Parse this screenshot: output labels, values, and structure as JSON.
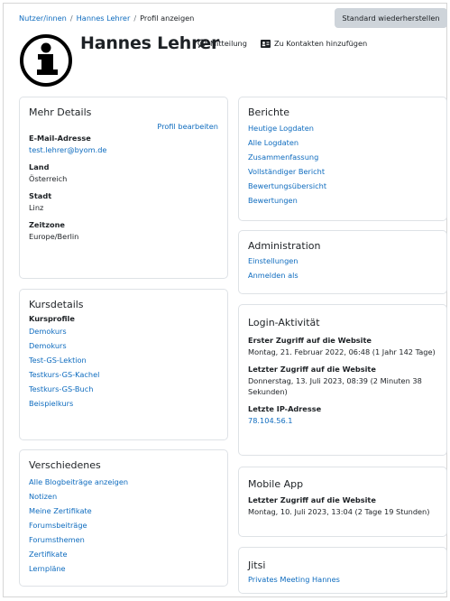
{
  "breadcrumb": {
    "items": [
      "Nutzer/innen",
      "Hannes Lehrer",
      "Profil anzeigen"
    ],
    "separator": "/"
  },
  "reset_button": "Standard wiederherstellen",
  "user": {
    "name": "Hannes Lehrer"
  },
  "header_actions": {
    "message": "Mitteilung",
    "add_contact": "Zu Kontakten hinzufügen"
  },
  "more_details": {
    "title": "Mehr Details",
    "edit": "Profil bearbeiten",
    "fields": [
      {
        "label": "E-Mail-Adresse",
        "value": "test.lehrer@byom.de"
      },
      {
        "label": "Land",
        "value": "Österreich"
      },
      {
        "label": "Stadt",
        "value": "Linz"
      },
      {
        "label": "Zeitzone",
        "value": "Europe/Berlin"
      }
    ]
  },
  "course_details": {
    "title": "Kursdetails",
    "subtitle": "Kursprofile",
    "courses": [
      "Demokurs",
      "Demokurs",
      "Test-GS-Lektion",
      "Testkurs-GS-Kachel",
      "Testkurs-GS-Buch",
      "Beispielkurs"
    ]
  },
  "misc": {
    "title": "Verschiedenes",
    "links": [
      "Alle Blogbeiträge anzeigen",
      "Notizen",
      "Meine Zertifikate",
      "Forumsbeiträge",
      "Forumsthemen",
      "Zertifikate",
      "Lernpläne"
    ]
  },
  "reports": {
    "title": "Berichte",
    "links": [
      "Heutige Logdaten",
      "Alle Logdaten",
      "Zusammenfassung",
      "Vollständiger Bericht",
      "Bewertungsübersicht",
      "Bewertungen"
    ]
  },
  "administration": {
    "title": "Administration",
    "links": [
      "Einstellungen",
      "Anmelden als"
    ]
  },
  "login_activity": {
    "title": "Login-Aktivität",
    "first_label": "Erster Zugriff auf die Website",
    "first_value": "Montag, 21. Februar 2022, 06:48  (1 Jahr 142 Tage)",
    "last_label": "Letzter Zugriff auf die Website",
    "last_value": "Donnerstag, 13. Juli 2023, 08:39  (2 Minuten 38 Sekunden)",
    "ip_label": "Letzte IP-Adresse",
    "ip_value": "78.104.56.1"
  },
  "mobile_app": {
    "title": "Mobile App",
    "label": "Letzter Zugriff auf die Website",
    "value": "Montag, 10. Juli 2023, 13:04  (2 Tage 19 Stunden)"
  },
  "jitsi": {
    "title": "Jitsi",
    "link": "Privates Meeting Hannes"
  }
}
